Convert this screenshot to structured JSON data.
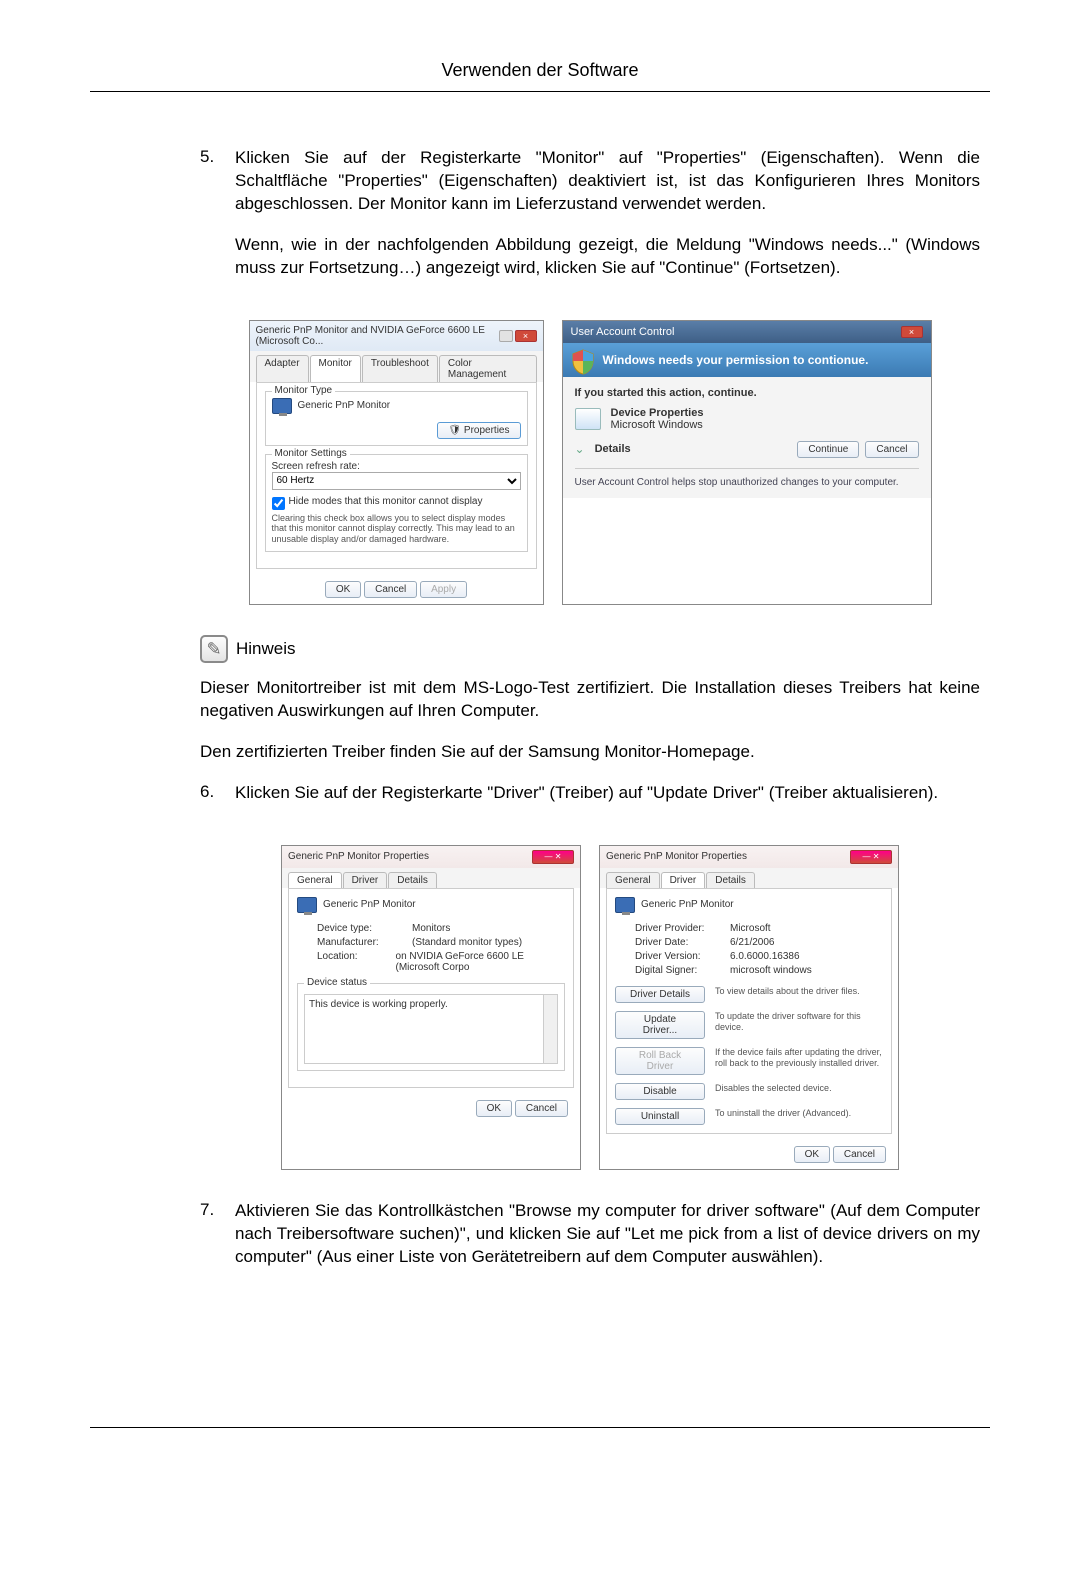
{
  "header": {
    "title": "Verwenden der Software"
  },
  "step5": {
    "num": "5.",
    "p1": "Klicken Sie auf der Registerkarte \"Monitor\" auf \"Properties\" (Eigenschaften). Wenn die Schaltfläche \"Properties\" (Eigenschaften) deaktiviert ist, ist das Konfigurieren Ihres Monitors abgeschlossen. Der Monitor kann im Lieferzustand verwendet werden.",
    "p2": "Wenn, wie in der nachfolgenden Abbildung gezeigt, die Meldung \"Windows needs...\" (Windows muss zur Fortsetzung…) angezeigt wird, klicken Sie auf \"Continue\" (Fortsetzen)."
  },
  "monitorDlg": {
    "title": "Generic PnP Monitor and NVIDIA GeForce 6600 LE (Microsoft Co...",
    "tabs": {
      "adapter": "Adapter",
      "monitor": "Monitor",
      "troubleshoot": "Troubleshoot",
      "color": "Color Management"
    },
    "monitorTypeLabel": "Monitor Type",
    "monitorName": "Generic PnP Monitor",
    "propertiesBtn": "Properties",
    "settingsLabel": "Monitor Settings",
    "refreshLabel": "Screen refresh rate:",
    "refreshValue": "60 Hertz",
    "hideModes": "Hide modes that this monitor cannot display",
    "hideHint": "Clearing this check box allows you to select display modes that this monitor cannot display correctly. This may lead to an unusable display and/or damaged hardware.",
    "ok": "OK",
    "cancel": "Cancel",
    "apply": "Apply"
  },
  "uac": {
    "title": "User Account Control",
    "headline": "Windows needs your permission to contionue.",
    "ifStarted": "If you started this action, continue.",
    "app": "Device Properties",
    "vendor": "Microsoft Windows",
    "details": "Details",
    "continue": "Continue",
    "cancel": "Cancel",
    "footer": "User Account Control helps stop unauthorized changes to your computer."
  },
  "note": {
    "label": "Hinweis",
    "p1": "Dieser Monitortreiber ist mit dem MS-Logo-Test zertifiziert. Die Installation dieses Treibers hat keine negativen Auswirkungen auf Ihren Computer.",
    "p2": "Den zertifizierten Treiber finden Sie auf der Samsung Monitor-Homepage."
  },
  "step6": {
    "num": "6.",
    "p1": "Klicken Sie auf der Registerkarte \"Driver\" (Treiber) auf \"Update Driver\" (Treiber aktualisieren)."
  },
  "genDlg": {
    "title": "Generic PnP Monitor Properties",
    "tabs": {
      "general": "General",
      "driver": "Driver",
      "details": "Details"
    },
    "monitorName": "Generic PnP Monitor",
    "deviceType": {
      "k": "Device type:",
      "v": "Monitors"
    },
    "manufacturer": {
      "k": "Manufacturer:",
      "v": "(Standard monitor types)"
    },
    "location": {
      "k": "Location:",
      "v": "on NVIDIA GeForce 6600 LE (Microsoft Corpo"
    },
    "statusLabel": "Device status",
    "statusText": "This device is working properly.",
    "ok": "OK",
    "cancel": "Cancel"
  },
  "drvDlg": {
    "title": "Generic PnP Monitor Properties",
    "tabs": {
      "general": "General",
      "driver": "Driver",
      "details": "Details"
    },
    "monitorName": "Generic PnP Monitor",
    "provider": {
      "k": "Driver Provider:",
      "v": "Microsoft"
    },
    "date": {
      "k": "Driver Date:",
      "v": "6/21/2006"
    },
    "version": {
      "k": "Driver Version:",
      "v": "6.0.6000.16386"
    },
    "signer": {
      "k": "Digital Signer:",
      "v": "microsoft windows"
    },
    "btnDetails": {
      "label": "Driver Details",
      "desc": "To view details about the driver files."
    },
    "btnUpdate": {
      "label": "Update Driver...",
      "desc": "To update the driver software for this device."
    },
    "btnRollback": {
      "label": "Roll Back Driver",
      "desc": "If the device fails after updating the driver, roll back to the previously installed driver."
    },
    "btnDisable": {
      "label": "Disable",
      "desc": "Disables the selected device."
    },
    "btnUninstall": {
      "label": "Uninstall",
      "desc": "To uninstall the driver (Advanced)."
    },
    "ok": "OK",
    "cancel": "Cancel"
  },
  "step7": {
    "num": "7.",
    "p1": "Aktivieren Sie das Kontrollkästchen \"Browse my computer for driver software\" (Auf dem Computer nach Treibersoftware suchen)\", und klicken Sie auf \"Let me pick from a list of device drivers on my computer\" (Aus einer Liste von Gerätetreibern auf dem Computer auswählen)."
  }
}
